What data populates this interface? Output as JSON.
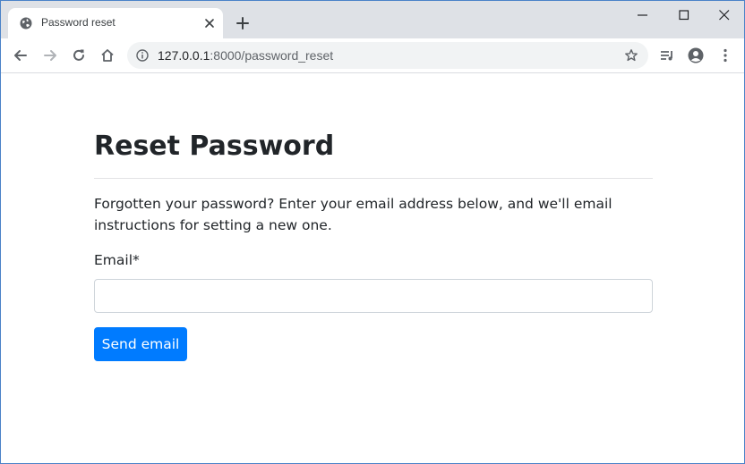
{
  "browser": {
    "tab": {
      "title": "Password reset",
      "favicon": "globe-icon"
    },
    "address_bar": {
      "url_host": "127.0.0.1",
      "url_path": ":8000/password_reset"
    },
    "icons": {
      "back": "arrow-left-icon",
      "forward": "arrow-right-icon",
      "reload": "reload-icon",
      "home": "home-icon",
      "info": "info-icon",
      "bookmark": "star-icon",
      "media": "playlist-icon",
      "profile": "account-icon",
      "menu": "more-vertical-icon"
    }
  },
  "page": {
    "title": "Reset Password",
    "intro": "Forgotten your password? Enter your email address below, and we'll email instructions for setting a new one.",
    "email_label": "Email*",
    "email_value": "",
    "submit_label": "Send email"
  },
  "colors": {
    "primary": "#007bff",
    "tabstrip": "#dee1e6",
    "omnibox": "#f1f3f4",
    "text": "#212529"
  }
}
